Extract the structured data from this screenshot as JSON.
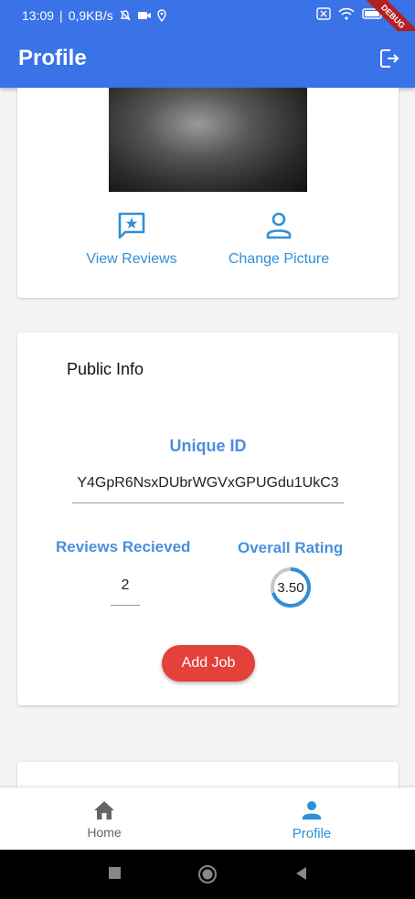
{
  "status_bar": {
    "time": "13:09",
    "network_speed": "0,9KB/s",
    "debug_label": "DEBUG"
  },
  "app_bar": {
    "title": "Profile",
    "logout_icon": "logout-icon"
  },
  "top_card": {
    "view_reviews_label": "View Reviews",
    "change_picture_label": "Change Picture"
  },
  "info_card": {
    "title": "Public Info",
    "unique_id_label": "Unique ID",
    "unique_id_value": "Y4GpR6NsxDUbrWGVxGPUGdu1UkC3",
    "reviews_label": "Reviews Recieved",
    "reviews_value": "2",
    "rating_label": "Overall Rating",
    "rating_value": "3.50",
    "rating_fraction": 0.7,
    "add_job_label": "Add Job"
  },
  "bottom_nav": {
    "items": [
      {
        "label": "Home",
        "icon": "home-icon",
        "active": false
      },
      {
        "label": "Profile",
        "icon": "person-icon",
        "active": true
      }
    ]
  },
  "colors": {
    "primary": "#3a72e8",
    "accent": "#2f8fd8",
    "button": "#e3413a"
  }
}
